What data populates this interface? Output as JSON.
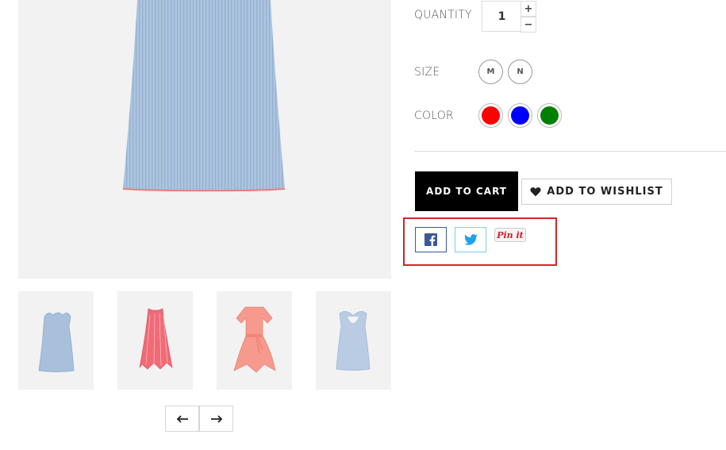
{
  "product": {
    "main_image": {
      "alt": "",
      "colors": {
        "fabric": "#a9c1dc",
        "stripe": "#8eabcf",
        "trim": "#f07a7a",
        "background": "#f2f2f2"
      }
    },
    "thumbnails": [
      {
        "icon": "blue-ruffle-dress-thumb",
        "color": "#a8c0dc"
      },
      {
        "icon": "pink-stripe-dress-thumb",
        "color": "#ef6b78"
      },
      {
        "icon": "coral-wrap-dress-thumb",
        "color": "#f59a8d"
      },
      {
        "icon": "blue-back-dress-thumb",
        "color": "#b9cce3"
      }
    ],
    "carousel": {
      "prev_icon": "arrow-left-icon",
      "next_icon": "arrow-right-icon"
    }
  },
  "options": {
    "quantity": {
      "label": "QUANTITY",
      "value": "1",
      "increment": "+",
      "decrement": "−"
    },
    "size": {
      "label": "SIZE",
      "values": [
        "M",
        "N"
      ]
    },
    "color": {
      "label": "COLOR",
      "values": [
        {
          "name": "red",
          "hex": "#ff0000"
        },
        {
          "name": "blue",
          "hex": "#0000ff"
        },
        {
          "name": "green",
          "hex": "#008000"
        }
      ]
    }
  },
  "actions": {
    "add_to_cart": "ADD TO CART",
    "add_to_wishlist": "ADD TO WISHLIST",
    "wishlist_icon": "heart-icon"
  },
  "share": {
    "highlight_color": "#d3242b",
    "facebook": {
      "icon": "facebook-icon",
      "color": "#3b5998"
    },
    "twitter": {
      "icon": "twitter-icon",
      "color": "#1da1f2"
    },
    "pinterest": {
      "label": "Pin it",
      "color": "#c8232c"
    }
  }
}
